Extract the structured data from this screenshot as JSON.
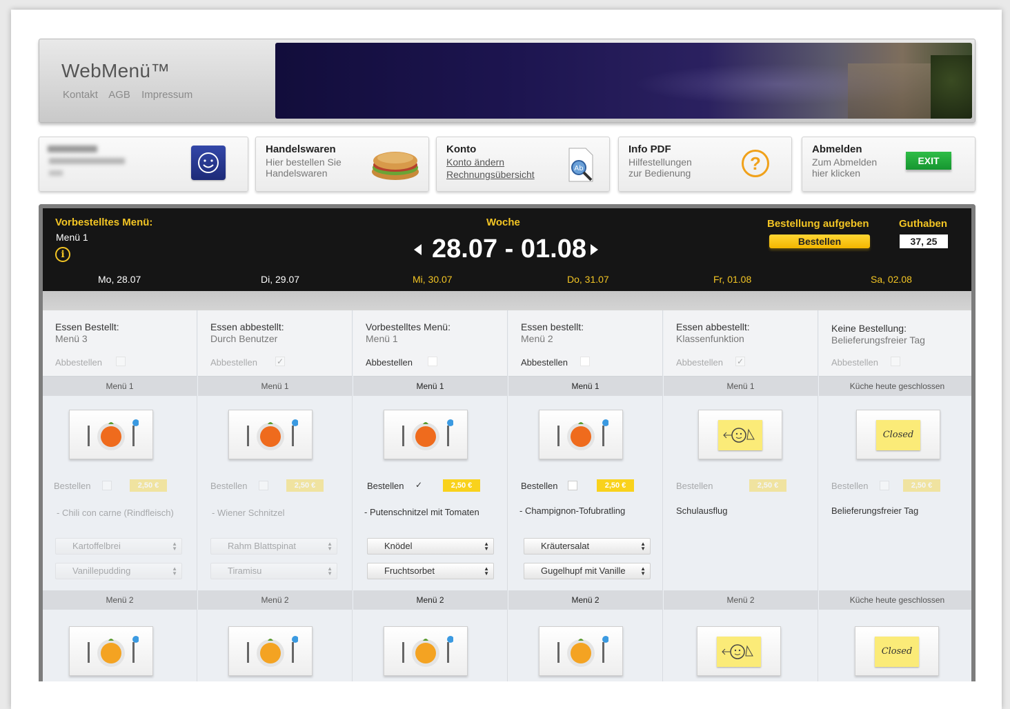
{
  "header": {
    "title": "WebMenü™",
    "links": [
      "Kontakt",
      "AGB",
      "Impressum"
    ]
  },
  "cards": {
    "handelswaren": {
      "title": "Handelswaren",
      "line1": "Hier bestellen Sie",
      "line2": "Handelswaren"
    },
    "konto": {
      "title": "Konto",
      "link1": "Konto ändern",
      "link2": "Rechnungsübersicht"
    },
    "info": {
      "title": "Info PDF",
      "line1": "Hilfestellungen",
      "line2": "zur Bedienung"
    },
    "abmelden": {
      "title": "Abmelden",
      "line1": "Zum Abmelden",
      "line2": "hier klicken",
      "exit_label": "EXIT"
    }
  },
  "week": {
    "preorder_label": "Vorbestelltes Menü:",
    "preorder_value": "Menü 1",
    "woche_label": "Woche",
    "range": "28.07 - 01.08",
    "order_label": "Bestellung aufgeben",
    "order_button": "Bestellen",
    "balance_label": "Guthaben",
    "balance_value": "37, 25",
    "days": [
      "Mo, 28.07",
      "Di, 29.07",
      "Mi, 30.07",
      "Do, 31.07",
      "Fr, 01.08",
      "Sa, 02.08"
    ]
  },
  "columns": [
    {
      "status_title": "Essen Bestellt:",
      "status_sub": "Menü 3",
      "cancel_label": "Abbestellen",
      "cancel_checked": "",
      "menu1_label": "Menü 1",
      "order_label": "Bestellen",
      "order_checked": "",
      "price": "2,50 €",
      "dish": "- Chili con carne (Rindfleisch)",
      "side1": "Kartoffelbrei",
      "side2": "Vanillepudding",
      "menu2_label": "Menü 2"
    },
    {
      "status_title": "Essen abbestellt:",
      "status_sub": "Durch Benutzer",
      "cancel_label": "Abbestellen",
      "cancel_checked": "✓",
      "menu1_label": "Menü 1",
      "order_label": "Bestellen",
      "order_checked": "",
      "price": "2,50 €",
      "dish": "- Wiener Schnitzel",
      "side1": "Rahm Blattspinat",
      "side2": "Tiramisu",
      "menu2_label": "Menü 2"
    },
    {
      "status_title": "Vorbestelltes Menü:",
      "status_sub": "Menü 1",
      "cancel_label": "Abbestellen",
      "cancel_checked": "",
      "menu1_label": "Menü 1",
      "order_label": "Bestellen",
      "order_checked": "✓",
      "price": "2,50 €",
      "dish": "- Putenschnitzel mit Tomaten",
      "side1": "Knödel",
      "side2": "Fruchtsorbet",
      "menu2_label": "Menü 2"
    },
    {
      "status_title": "Essen bestellt:",
      "status_sub": "Menü 2",
      "cancel_label": "Abbestellen",
      "cancel_checked": "",
      "menu1_label": "Menü 1",
      "order_label": "Bestellen",
      "order_checked": "",
      "price": "2,50 €",
      "dish": "- Champignon-Tofubratling",
      "side1": "Kräutersalat",
      "side2": "Gugelhupf mit Vanille",
      "menu2_label": "Menü 2"
    },
    {
      "status_title": "Essen abbestellt:",
      "status_sub": "Klassenfunktion",
      "cancel_label": "Abbestellen",
      "cancel_checked": "✓",
      "menu1_label": "Menü 1",
      "order_label": "Bestellen",
      "order_checked": "",
      "price": "2,50 €",
      "dish": "Schulausflug",
      "menu2_label": "Menü 2"
    },
    {
      "status_title": "Keine Bestellung:",
      "status_sub": "Belieferungsfreier Tag",
      "cancel_label": "Abbestellen",
      "cancel_checked": "",
      "menu1_label": "Küche heute geschlossen",
      "order_label": "Bestellen",
      "order_checked": "",
      "price": "2,50 €",
      "dish": "Belieferungsfreier Tag",
      "closed_label": "Closed",
      "menu2_label": "Küche heute geschlossen"
    }
  ]
}
